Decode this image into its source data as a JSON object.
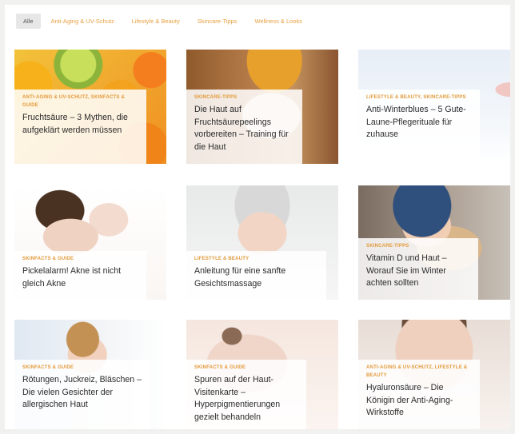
{
  "filters": [
    {
      "label": "Alle",
      "active": true
    },
    {
      "label": "Anti-Aging & UV-Schutz",
      "active": false
    },
    {
      "label": "Lifestyle & Beauty",
      "active": false
    },
    {
      "label": "Skincare-Tipps",
      "active": false
    },
    {
      "label": "Wellness & Looks",
      "active": false
    }
  ],
  "cards": [
    {
      "category": "Anti-Aging & UV-Schutz, Skinfacts & Guide",
      "title": "Fruchtsäure – 3 Mythen, die aufgeklärt werden müssen",
      "image": "citrus-fruits"
    },
    {
      "category": "Skincare-Tipps",
      "title": "Die Haut auf Fruchtsäurepeelings vorbereiten – Training für die Haut",
      "image": "woman-with-headband"
    },
    {
      "category": "Lifestyle & Beauty, Skincare-Tipps",
      "title": "Anti-Winterblues – 5 Gute-Laune-Pflegerituale für zuhause",
      "image": "winter-portrait"
    },
    {
      "category": "Skinfacts & Guide",
      "title": "Pickelalarm! Akne ist nicht gleich Akne",
      "image": "woman-touching-forehead"
    },
    {
      "category": "Lifestyle & Beauty",
      "title": "Anleitung für eine sanfte Gesichtsmassage",
      "image": "woman-in-towel"
    },
    {
      "category": "Skincare-Tipps",
      "title": "Vitamin D und Haut – Worauf Sie im Winter achten sollten",
      "image": "woman-in-beanie"
    },
    {
      "category": "Skinfacts & Guide",
      "title": "Rötungen, Juckreiz, Bläschen – Die vielen Gesichter der allergischen Haut",
      "image": "woman-scratching"
    },
    {
      "category": "Skinfacts & Guide",
      "title": "Spuren auf der Haut-Visitenkarte – Hyperpigmentierungen gezielt behandeln",
      "image": "shoulder-skin"
    },
    {
      "category": "Anti-Aging & UV-Schutz, Lifestyle & Beauty",
      "title": "Hyaluronsäure – Die Königin der Anti-Aging-Wirkstoffe",
      "image": "woman-face-closeup"
    }
  ]
}
